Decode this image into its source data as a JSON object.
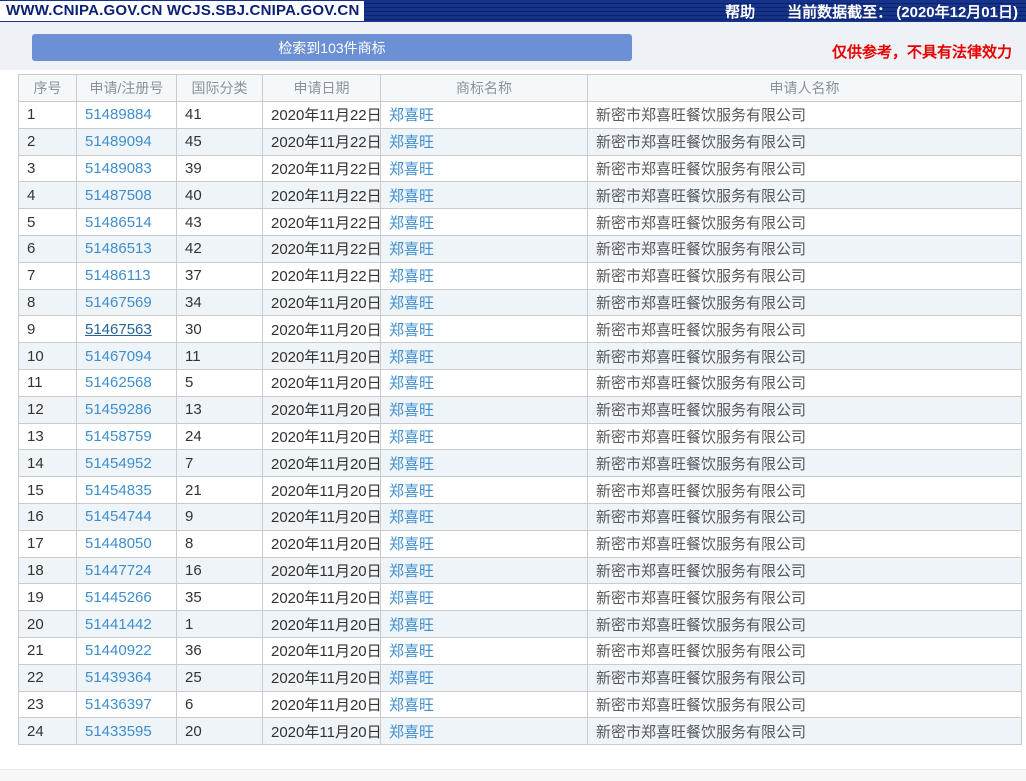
{
  "topbar": {
    "site_text": "WWW.CNIPA.GOV.CN WCJS.SBJ.CNIPA.GOV.CN",
    "help_label": "帮助",
    "data_cutoff": "当前数据截至：  (2020年12月01日)"
  },
  "banner": {
    "result_count_label": "检索到103件商标",
    "disclaimer": "仅供参考，不具有法律效力"
  },
  "table": {
    "headers": [
      "序号",
      "申请/注册号",
      "国际分类",
      "申请日期",
      "商标名称",
      "申请人名称"
    ],
    "rows": [
      {
        "no": "1",
        "reg_no": "51489884",
        "intl_class": "41",
        "app_date": "2020年11月22日",
        "mark_name": "郑喜旺",
        "applicant": "新密市郑喜旺餐饮服务有限公司"
      },
      {
        "no": "2",
        "reg_no": "51489094",
        "intl_class": "45",
        "app_date": "2020年11月22日",
        "mark_name": "郑喜旺",
        "applicant": "新密市郑喜旺餐饮服务有限公司"
      },
      {
        "no": "3",
        "reg_no": "51489083",
        "intl_class": "39",
        "app_date": "2020年11月22日",
        "mark_name": "郑喜旺",
        "applicant": "新密市郑喜旺餐饮服务有限公司"
      },
      {
        "no": "4",
        "reg_no": "51487508",
        "intl_class": "40",
        "app_date": "2020年11月22日",
        "mark_name": "郑喜旺",
        "applicant": "新密市郑喜旺餐饮服务有限公司"
      },
      {
        "no": "5",
        "reg_no": "51486514",
        "intl_class": "43",
        "app_date": "2020年11月22日",
        "mark_name": "郑喜旺",
        "applicant": "新密市郑喜旺餐饮服务有限公司"
      },
      {
        "no": "6",
        "reg_no": "51486513",
        "intl_class": "42",
        "app_date": "2020年11月22日",
        "mark_name": "郑喜旺",
        "applicant": "新密市郑喜旺餐饮服务有限公司"
      },
      {
        "no": "7",
        "reg_no": "51486113",
        "intl_class": "37",
        "app_date": "2020年11月22日",
        "mark_name": "郑喜旺",
        "applicant": "新密市郑喜旺餐饮服务有限公司"
      },
      {
        "no": "8",
        "reg_no": "51467569",
        "intl_class": "34",
        "app_date": "2020年11月20日",
        "mark_name": "郑喜旺",
        "applicant": "新密市郑喜旺餐饮服务有限公司"
      },
      {
        "no": "9",
        "reg_no": "51467563",
        "intl_class": "30",
        "app_date": "2020年11月20日",
        "mark_name": "郑喜旺",
        "applicant": "新密市郑喜旺餐饮服务有限公司",
        "visited": true
      },
      {
        "no": "10",
        "reg_no": "51467094",
        "intl_class": "11",
        "app_date": "2020年11月20日",
        "mark_name": "郑喜旺",
        "applicant": "新密市郑喜旺餐饮服务有限公司"
      },
      {
        "no": "11",
        "reg_no": "51462568",
        "intl_class": "5",
        "app_date": "2020年11月20日",
        "mark_name": "郑喜旺",
        "applicant": "新密市郑喜旺餐饮服务有限公司"
      },
      {
        "no": "12",
        "reg_no": "51459286",
        "intl_class": "13",
        "app_date": "2020年11月20日",
        "mark_name": "郑喜旺",
        "applicant": "新密市郑喜旺餐饮服务有限公司"
      },
      {
        "no": "13",
        "reg_no": "51458759",
        "intl_class": "24",
        "app_date": "2020年11月20日",
        "mark_name": "郑喜旺",
        "applicant": "新密市郑喜旺餐饮服务有限公司"
      },
      {
        "no": "14",
        "reg_no": "51454952",
        "intl_class": "7",
        "app_date": "2020年11月20日",
        "mark_name": "郑喜旺",
        "applicant": "新密市郑喜旺餐饮服务有限公司"
      },
      {
        "no": "15",
        "reg_no": "51454835",
        "intl_class": "21",
        "app_date": "2020年11月20日",
        "mark_name": "郑喜旺",
        "applicant": "新密市郑喜旺餐饮服务有限公司"
      },
      {
        "no": "16",
        "reg_no": "51454744",
        "intl_class": "9",
        "app_date": "2020年11月20日",
        "mark_name": "郑喜旺",
        "applicant": "新密市郑喜旺餐饮服务有限公司"
      },
      {
        "no": "17",
        "reg_no": "51448050",
        "intl_class": "8",
        "app_date": "2020年11月20日",
        "mark_name": "郑喜旺",
        "applicant": "新密市郑喜旺餐饮服务有限公司"
      },
      {
        "no": "18",
        "reg_no": "51447724",
        "intl_class": "16",
        "app_date": "2020年11月20日",
        "mark_name": "郑喜旺",
        "applicant": "新密市郑喜旺餐饮服务有限公司"
      },
      {
        "no": "19",
        "reg_no": "51445266",
        "intl_class": "35",
        "app_date": "2020年11月20日",
        "mark_name": "郑喜旺",
        "applicant": "新密市郑喜旺餐饮服务有限公司"
      },
      {
        "no": "20",
        "reg_no": "51441442",
        "intl_class": "1",
        "app_date": "2020年11月20日",
        "mark_name": "郑喜旺",
        "applicant": "新密市郑喜旺餐饮服务有限公司"
      },
      {
        "no": "21",
        "reg_no": "51440922",
        "intl_class": "36",
        "app_date": "2020年11月20日",
        "mark_name": "郑喜旺",
        "applicant": "新密市郑喜旺餐饮服务有限公司"
      },
      {
        "no": "22",
        "reg_no": "51439364",
        "intl_class": "25",
        "app_date": "2020年11月20日",
        "mark_name": "郑喜旺",
        "applicant": "新密市郑喜旺餐饮服务有限公司"
      },
      {
        "no": "23",
        "reg_no": "51436397",
        "intl_class": "6",
        "app_date": "2020年11月20日",
        "mark_name": "郑喜旺",
        "applicant": "新密市郑喜旺餐饮服务有限公司"
      },
      {
        "no": "24",
        "reg_no": "51433595",
        "intl_class": "20",
        "app_date": "2020年11月20日",
        "mark_name": "郑喜旺",
        "applicant": "新密市郑喜旺餐饮服务有限公司"
      }
    ]
  },
  "colors": {
    "topbar_bg": "#16338c",
    "topbar_stripe": "#0c2167",
    "banner_button": "#6c90d4",
    "link": "#3e8ece",
    "link_visited": "#2a6496",
    "disclaimer_red": "#e60000",
    "row_alt_bg": "#eff4f9",
    "header_bg": "#f4f8fb"
  }
}
